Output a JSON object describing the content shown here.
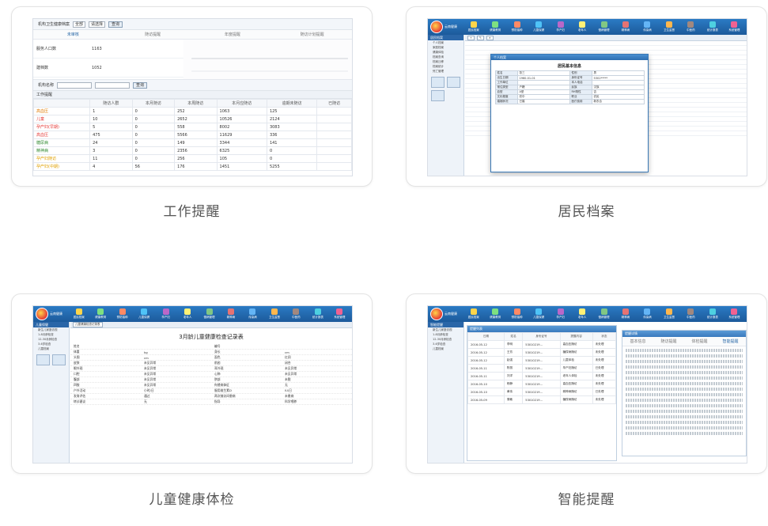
{
  "cards": [
    {
      "id": "work",
      "caption": "工作提醒"
    },
    {
      "id": "resident",
      "caption": "居民档案"
    },
    {
      "id": "child",
      "caption": "儿童健康体检"
    },
    {
      "id": "smart",
      "caption": "智能提醒"
    }
  ],
  "work": {
    "filter_label": "机构卫生健康档案",
    "select1": "全部",
    "select2": "请选择",
    "search_button": "查询",
    "tabs": [
      "未审核",
      "随访提醒",
      "年度提醒",
      "随访计划提醒"
    ],
    "summary": [
      {
        "label": "服务人口数",
        "value": "1163"
      },
      {
        "label": "建档数",
        "value": "1052"
      }
    ],
    "filter2_label": "机构名称",
    "filter2_button": "查询",
    "section": "工作提醒",
    "headers": [
      "",
      "随访人群",
      "本月随访",
      "本周随访",
      "本月应随访",
      "逾期未随访",
      "已随访"
    ],
    "rows": [
      {
        "name": "高血压",
        "color": "#e07b00",
        "cells": [
          "1",
          "0",
          "252",
          "1063",
          "125"
        ]
      },
      {
        "name": "儿童",
        "color": "#e53935",
        "cells": [
          "10",
          "0",
          "2652",
          "10526",
          "2124"
        ]
      },
      {
        "name": "孕产妇(早期)",
        "color": "#e53935",
        "cells": [
          "5",
          "0",
          "558",
          "8002",
          "3083"
        ]
      },
      {
        "name": "高血压",
        "color": "#e53935",
        "cells": [
          "475",
          "0",
          "5566",
          "11629",
          "336"
        ]
      },
      {
        "name": "糖尿病",
        "color": "#3a8f3a",
        "cells": [
          "24",
          "0",
          "149",
          "3344",
          "141"
        ]
      },
      {
        "name": "精神病",
        "color": "#3a8f3a",
        "cells": [
          "3",
          "0",
          "2356",
          "6325",
          "0"
        ]
      },
      {
        "name": "孕产妇随访",
        "color": "#e0a000",
        "cells": [
          "11",
          "0",
          "256",
          "105",
          "0"
        ]
      },
      {
        "name": "孕产妇(中期)",
        "color": "#e0a000",
        "cells": [
          "4",
          "56",
          "176",
          "1451",
          "5255"
        ]
      }
    ]
  },
  "resident": {
    "brand": "云南健康",
    "nav": [
      "居民档案",
      "健康教育",
      "预防接种",
      "儿童保健",
      "孕产妇",
      "老年人",
      "慢病管理",
      "精神病",
      "传染病",
      "卫生监督",
      "中医药",
      "统计报表",
      "系统管理"
    ],
    "side_head": "居民档案",
    "side_items": [
      "个人档案",
      "家庭档案",
      "健康体检",
      "档案查询",
      "档案迁移",
      "档案统计",
      "死亡管理"
    ],
    "modal_bar": "个人档案",
    "modal_title": "居民基本信息",
    "modal_fields": [
      [
        "姓名",
        "张三",
        "性别",
        "男"
      ],
      [
        "出生日期",
        "1960-01-01",
        "身份证号",
        "5301*****"
      ],
      [
        "工作单位",
        "",
        "本人电话",
        ""
      ],
      [
        "常住类型",
        "户籍",
        "民族",
        "汉族"
      ],
      [
        "血型",
        "A型",
        "RH阴性",
        "否"
      ],
      [
        "文化程度",
        "初中",
        "职业",
        "农民"
      ],
      [
        "婚姻状况",
        "已婚",
        "医疗费用",
        "新农合"
      ]
    ]
  },
  "child": {
    "brand": "云南健康",
    "tab": "儿童健康检查记录表",
    "form_title": "3月龄儿童健康检查记录表",
    "side_head": "儿童保健",
    "side_items": [
      "新生儿家庭访视",
      "1-8月龄检查",
      "12-30月龄检查",
      "3-6岁检查",
      "儿童档案"
    ],
    "fields": [
      [
        "姓名",
        "",
        "编号",
        ""
      ],
      [
        "体重",
        "kg",
        "身长",
        "cm"
      ],
      [
        "头围",
        "cm",
        "面色",
        "红润"
      ],
      [
        "皮肤",
        "未见异常",
        "前囟",
        "闭合"
      ],
      [
        "眼外观",
        "未见异常",
        "耳外观",
        "未见异常"
      ],
      [
        "口腔",
        "未见异常",
        "心肺",
        "未见异常"
      ],
      [
        "腹部",
        "未见异常",
        "脐部",
        "未脱"
      ],
      [
        "四肢",
        "未见异常",
        "佝偻病体征",
        "无"
      ],
      [
        "户外活动",
        "小时/日",
        "服用维生素D",
        "IU/日"
      ],
      [
        "发育评估",
        "通过",
        "两次随访间患病",
        "未患病"
      ],
      [
        "转诊建议",
        "无",
        "指导",
        "科学喂养"
      ]
    ]
  },
  "smart": {
    "brand": "云南健康",
    "side_head": "智能提醒",
    "list_bar": "提醒列表",
    "columns": [
      "日期",
      "姓名",
      "身份证号",
      "提醒内容",
      "状态"
    ],
    "rows": [
      [
        "2016-05-12",
        "李明",
        "53010219...",
        "高血压随访",
        "未处理"
      ],
      [
        "2016-05-12",
        "王芳",
        "53010219...",
        "糖尿病随访",
        "未处理"
      ],
      [
        "2016-05-12",
        "赵强",
        "53010219...",
        "儿童体检",
        "未处理"
      ],
      [
        "2016-05-11",
        "陈丽",
        "53010219...",
        "孕产妇随访",
        "已处理"
      ],
      [
        "2016-05-11",
        "刘洋",
        "53010219...",
        "老年人体检",
        "未处理"
      ],
      [
        "2016-05-10",
        "杨静",
        "53010219...",
        "高血压随访",
        "未处理"
      ],
      [
        "2016-05-10",
        "黄伟",
        "53010219...",
        "精神病随访",
        "已处理"
      ],
      [
        "2016-05-09",
        "周敏",
        "53010219...",
        "糖尿病随访",
        "未处理"
      ]
    ],
    "detail_bar": "提醒详情",
    "detail_tabs": [
      "基本信息",
      "随访提醒",
      "体检提醒",
      "智能提醒"
    ]
  }
}
